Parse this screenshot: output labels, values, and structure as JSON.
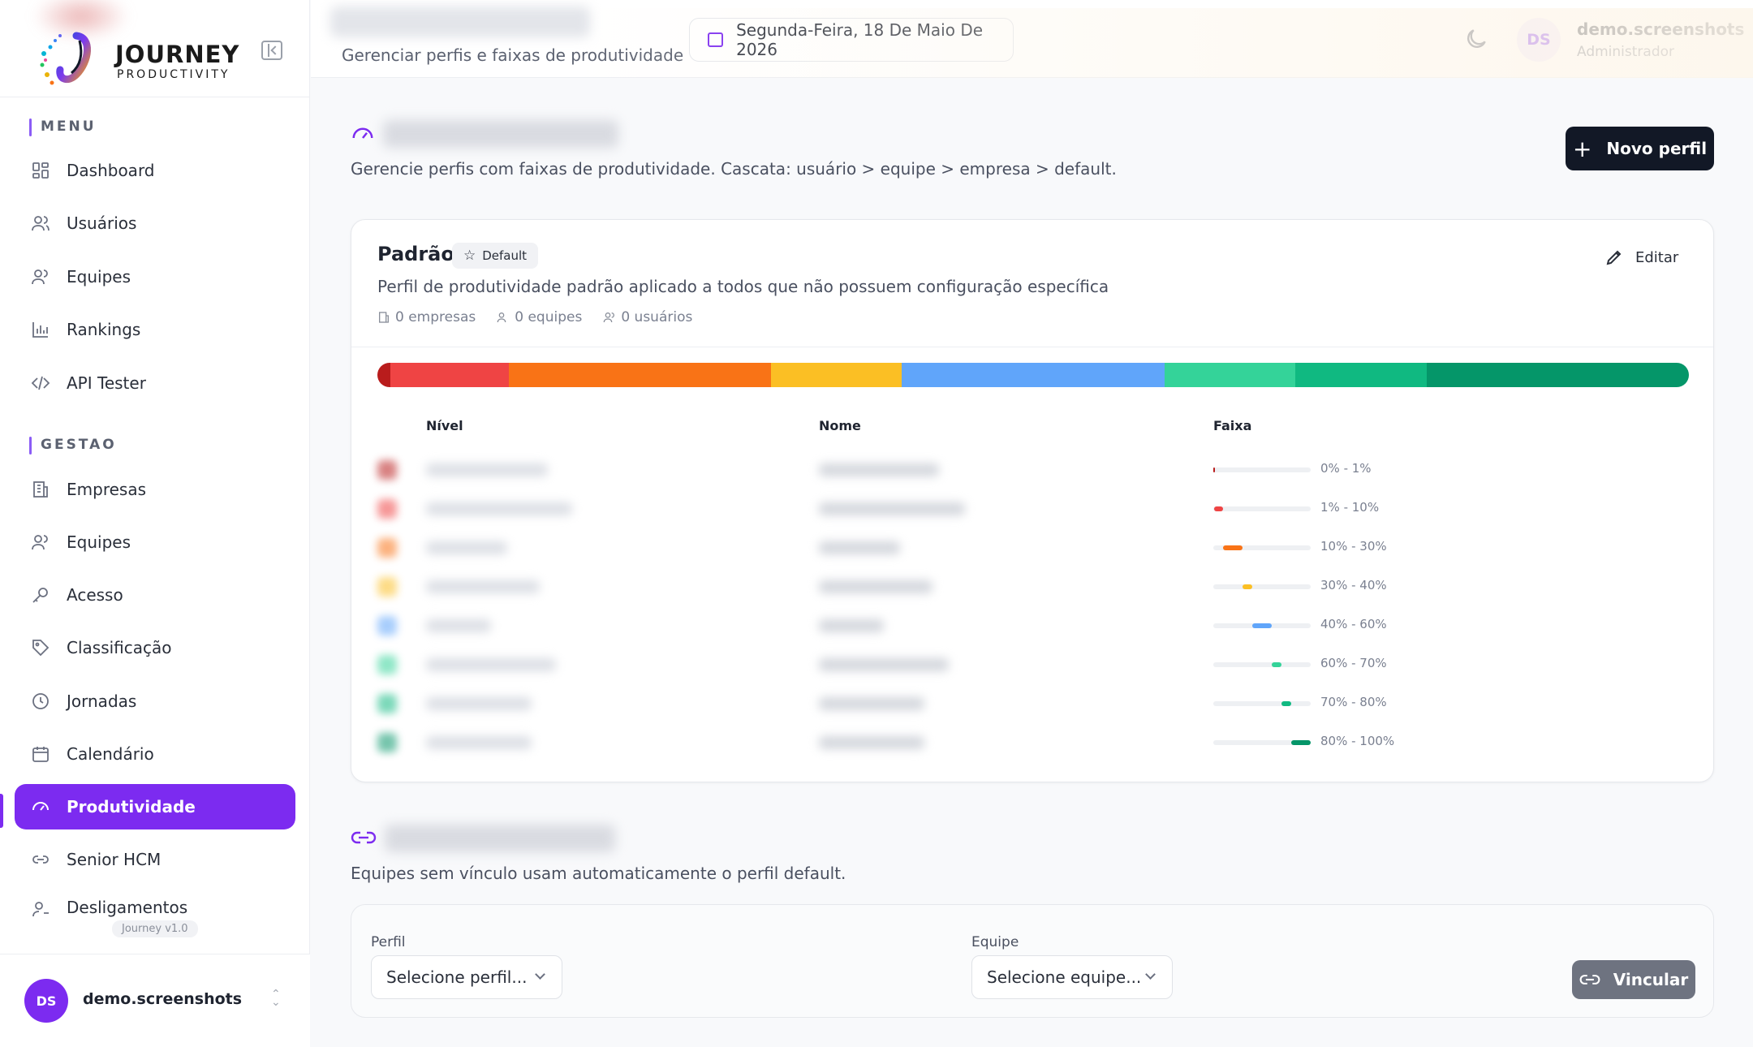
{
  "brand": {
    "name": "JOURNEY",
    "sub": "PRODUCTIVITY"
  },
  "sidebar": {
    "menu_label": "MENU",
    "menu_items": [
      {
        "label": "Dashboard",
        "icon": "dashboard-icon"
      },
      {
        "label": "Usuários",
        "icon": "users-icon"
      },
      {
        "label": "Equipes",
        "icon": "team-icon"
      },
      {
        "label": "Rankings",
        "icon": "bar-chart-icon"
      },
      {
        "label": "API Tester",
        "icon": "code-icon"
      }
    ],
    "gestao_label": "GESTAO",
    "gestao_items": [
      {
        "label": "Empresas",
        "icon": "building-icon"
      },
      {
        "label": "Equipes",
        "icon": "team-icon"
      },
      {
        "label": "Acesso",
        "icon": "key-icon"
      },
      {
        "label": "Classificação",
        "icon": "tag-icon"
      },
      {
        "label": "Jornadas",
        "icon": "clock-icon"
      },
      {
        "label": "Calendário",
        "icon": "calendar-icon"
      },
      {
        "label": "Produtividade",
        "icon": "gauge-icon",
        "active": true
      },
      {
        "label": "Senior HCM",
        "icon": "link-icon"
      },
      {
        "label": "Desligamentos",
        "icon": "user-minus-icon"
      }
    ],
    "version": "Journey v1.0",
    "footer_user": {
      "initials": "DS",
      "name": "demo.screenshots"
    }
  },
  "header": {
    "subtitle": "Gerenciar perfis e faixas de produtividade",
    "date": "Segunda-Feira, 18 De Maio De 2026",
    "user": {
      "initials": "DS",
      "name": "demo.screenshots",
      "role": "Administrador"
    }
  },
  "main": {
    "description": "Gerencie perfis com faixas de produtividade. Cascata: usuário > equipe > empresa > default.",
    "new_button": "Novo perfil"
  },
  "profile_card": {
    "title": "Padrão",
    "badge": "Default",
    "edit_label": "Editar",
    "description": "Perfil de produtividade padrão aplicado a todos que não possuem configuração específica",
    "stats": {
      "empresas": "0 empresas",
      "equipes": "0 equipes",
      "usuarios": "0 usuários"
    },
    "table_headers": {
      "nivel": "Nível",
      "nome": "Nome",
      "faixa": "Faixa"
    },
    "bands": [
      {
        "range": "0% - 1%",
        "min": 0,
        "max": 1,
        "color": "#b91c1c"
      },
      {
        "range": "1% - 10%",
        "min": 1,
        "max": 10,
        "color": "#ef4444"
      },
      {
        "range": "10% - 30%",
        "min": 10,
        "max": 30,
        "color": "#f97316"
      },
      {
        "range": "30% - 40%",
        "min": 30,
        "max": 40,
        "color": "#fbbf24"
      },
      {
        "range": "40% - 60%",
        "min": 40,
        "max": 60,
        "color": "#60a5fa"
      },
      {
        "range": "60% - 70%",
        "min": 60,
        "max": 70,
        "color": "#34d399"
      },
      {
        "range": "70% - 80%",
        "min": 70,
        "max": 80,
        "color": "#10b981"
      },
      {
        "range": "80% - 100%",
        "min": 80,
        "max": 100,
        "color": "#059669"
      }
    ]
  },
  "link_section": {
    "description": "Equipes sem vínculo usam automaticamente o perfil default.",
    "perfil_label": "Perfil",
    "perfil_placeholder": "Selecione perfil...",
    "equipe_label": "Equipe",
    "equipe_placeholder": "Selecione equipe...",
    "link_button": "Vincular"
  },
  "colors": {
    "accent": "#7c2bf0",
    "dark_button": "#121826"
  }
}
